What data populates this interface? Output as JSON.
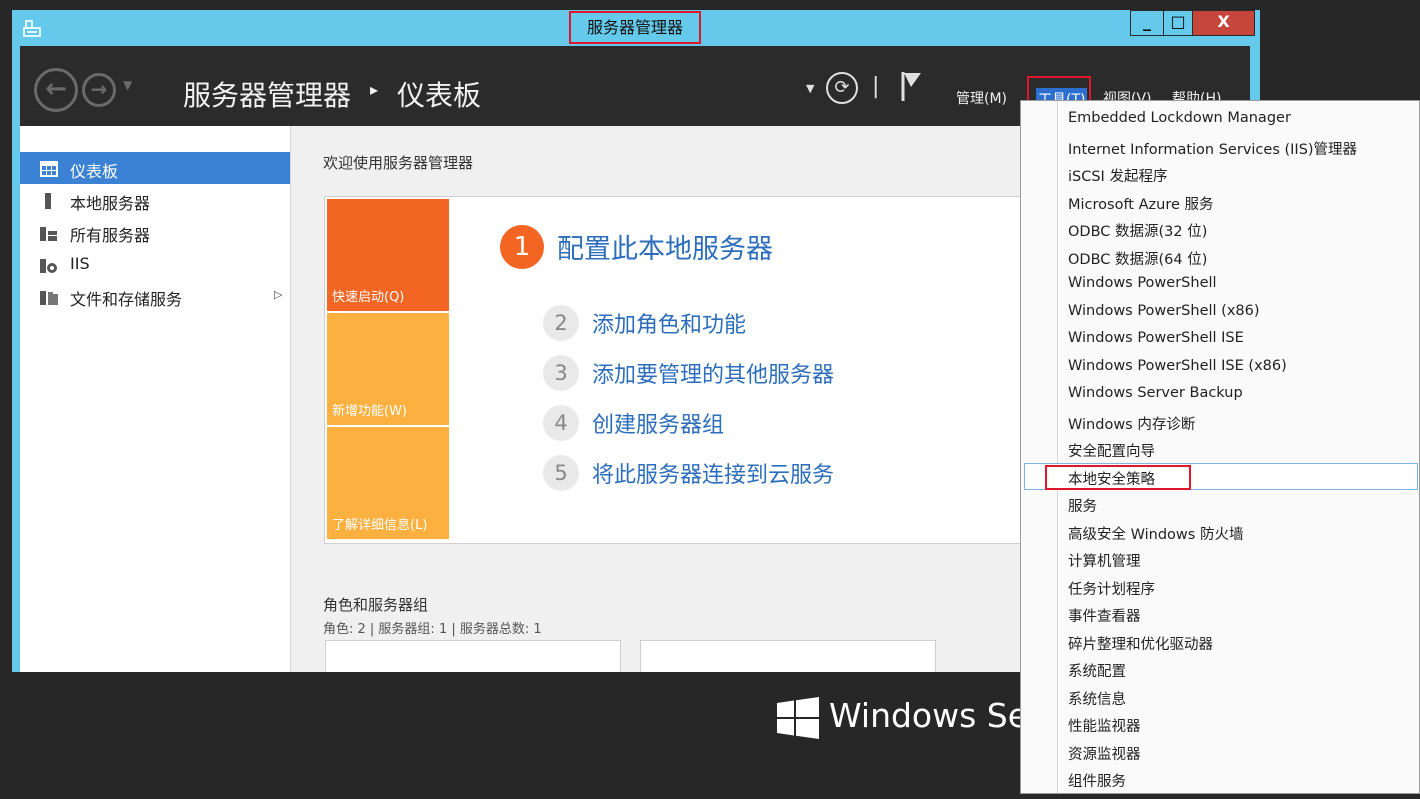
{
  "window": {
    "title": "服务器管理器",
    "controls": {
      "minimize": "_",
      "maximize": "□",
      "close": "X"
    }
  },
  "header": {
    "breadcrumb_root": "服务器管理器",
    "breadcrumb_separator": "▸",
    "breadcrumb_page": "仪表板",
    "menus": {
      "manage": "管理(M)",
      "tools": "工具(T)",
      "view": "视图(V)",
      "help": "帮助(H)"
    }
  },
  "sidebar": {
    "items": [
      {
        "label": "仪表板",
        "icon": "dashboard-icon",
        "selected": true
      },
      {
        "label": "本地服务器",
        "icon": "local-server-icon"
      },
      {
        "label": "所有服务器",
        "icon": "all-servers-icon"
      },
      {
        "label": "IIS",
        "icon": "iis-icon"
      },
      {
        "label": "文件和存储服务",
        "icon": "file-storage-icon",
        "has_submenu": true
      }
    ]
  },
  "main": {
    "welcome_title": "欢迎使用服务器管理器",
    "tiles": {
      "quick_start": "快速启动(Q)",
      "whats_new": "新增功能(W)",
      "learn_more": "了解详细信息(L)"
    },
    "steps": [
      {
        "num": "1",
        "label": "配置此本地服务器"
      },
      {
        "num": "2",
        "label": "添加角色和功能"
      },
      {
        "num": "3",
        "label": "添加要管理的其他服务器"
      },
      {
        "num": "4",
        "label": "创建服务器组"
      },
      {
        "num": "5",
        "label": "将此服务器连接到云服务"
      }
    ],
    "roles_title": "角色和服务器组",
    "roles_summary": "角色: 2 | 服务器组: 1 | 服务器总数: 1"
  },
  "brand": {
    "text": "Windows Serv"
  },
  "tools_menu": {
    "items": [
      "Embedded Lockdown Manager",
      "Internet Information Services (IIS)管理器",
      "iSCSI 发起程序",
      "Microsoft Azure 服务",
      "ODBC 数据源(32 位)",
      "ODBC 数据源(64 位)",
      "Windows PowerShell",
      "Windows PowerShell (x86)",
      "Windows PowerShell ISE",
      "Windows PowerShell ISE (x86)",
      "Windows Server Backup",
      "Windows 内存诊断",
      "安全配置向导",
      "本地安全策略",
      "服务",
      "高级安全 Windows 防火墙",
      "计算机管理",
      "任务计划程序",
      "事件查看器",
      "碎片整理和优化驱动器",
      "系统配置",
      "系统信息",
      "性能监视器",
      "资源监视器",
      "组件服务"
    ],
    "highlighted": "本地安全策略"
  },
  "colors": {
    "title_bar": "#64c9ea",
    "header_bg": "#2b2b2b",
    "accent_orange": "#f26522",
    "tile_yellow": "#fbb040",
    "link_blue": "#2c6ebc",
    "selection_blue": "#3c82d4",
    "highlight_red": "#e0162b"
  }
}
